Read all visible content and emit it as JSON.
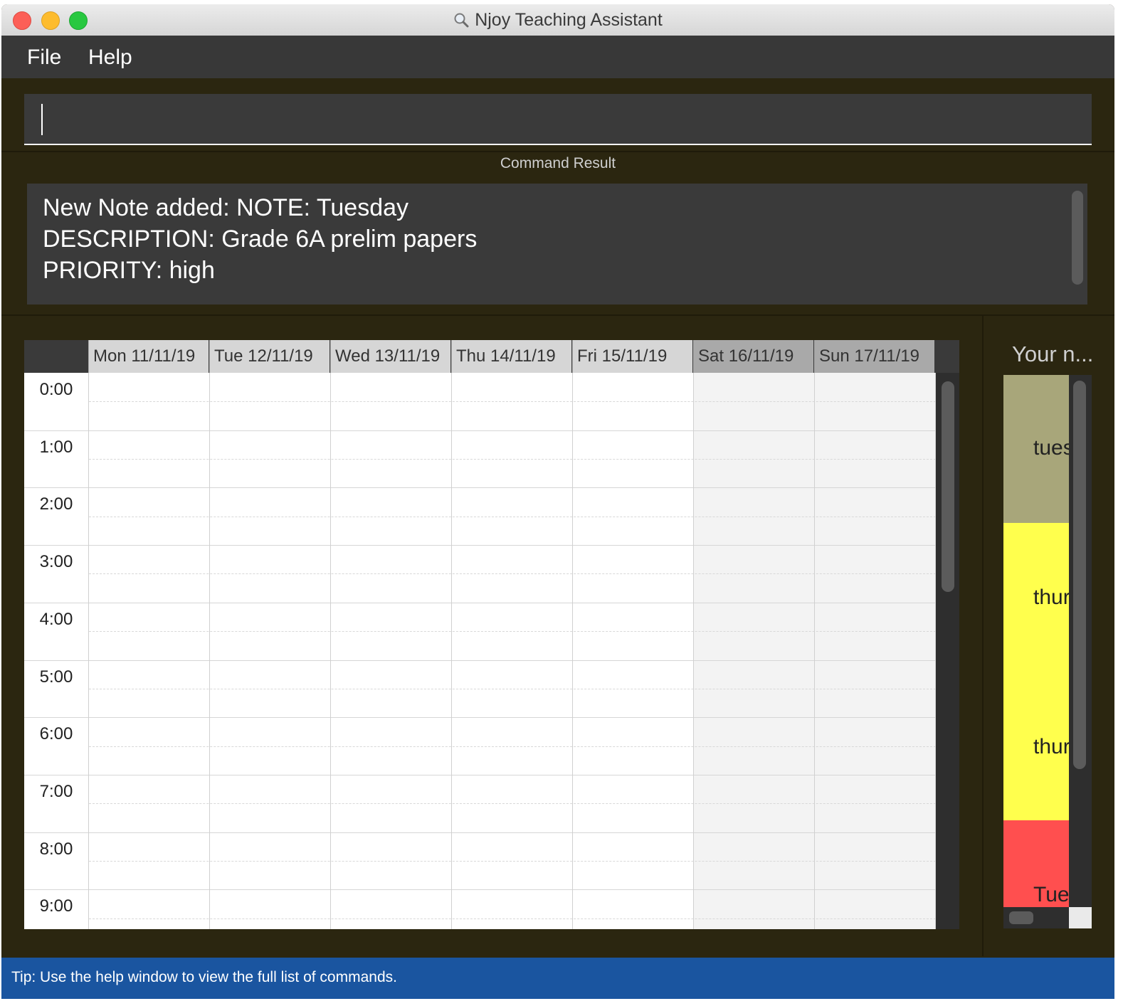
{
  "window": {
    "title": "Njoy Teaching Assistant"
  },
  "menu": {
    "file": "File",
    "help": "Help"
  },
  "command": {
    "value": "",
    "placeholder": ""
  },
  "result": {
    "label": "Command Result",
    "text": "New Note added: NOTE: Tuesday\nDESCRIPTION: Grade 6A prelim papers\nPRIORITY: high"
  },
  "calendar": {
    "days": [
      {
        "label": "Mon 11/11/19",
        "weekend": false
      },
      {
        "label": "Tue 12/11/19",
        "weekend": false
      },
      {
        "label": "Wed 13/11/19",
        "weekend": false
      },
      {
        "label": "Thu 14/11/19",
        "weekend": false
      },
      {
        "label": "Fri 15/11/19",
        "weekend": false
      },
      {
        "label": "Sat 16/11/19",
        "weekend": true
      },
      {
        "label": "Sun 17/11/19",
        "weekend": true
      }
    ],
    "hours": [
      "0:00",
      "1:00",
      "2:00",
      "3:00",
      "4:00",
      "5:00",
      "6:00",
      "7:00",
      "8:00",
      "9:00"
    ]
  },
  "notes": {
    "title": "Your n...",
    "items": [
      {
        "text": "tues",
        "color": "#a8a67a"
      },
      {
        "text": "thur",
        "color": "#ffff4d"
      },
      {
        "text": "thur",
        "color": "#ffff4d"
      },
      {
        "text": "Tue",
        "color": "#ff4f4f"
      }
    ]
  },
  "status": {
    "tip": "Tip: Use the help window to view the full list of commands."
  },
  "colors": {
    "window_bg": "#2b2610",
    "panel_bg": "#3a3a3a",
    "status_bar": "#1a55a0"
  }
}
